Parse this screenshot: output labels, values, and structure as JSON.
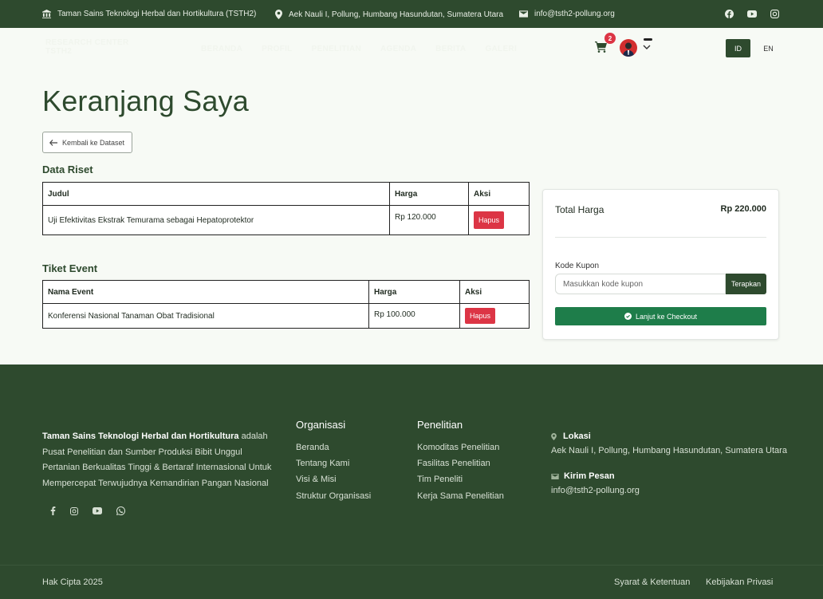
{
  "topbar": {
    "org": "Taman Sains Teknologi Herbal dan Hortikultura (TSTH2)",
    "address": "Aek Nauli I, Pollung, Humbang Hasundutan, Sumatera Utara",
    "email": "info@tsth2-pollung.org",
    "icons": [
      "bank-icon",
      "map-pin-icon",
      "mail-icon",
      "facebook-icon",
      "youtube-icon",
      "instagram-icon"
    ]
  },
  "nav": {
    "logo": "RESEARCH CENTER TSTH2",
    "links": [
      "BERANDA",
      "PROFIL",
      "PENELITIAN",
      "AGENDA",
      "BERITA",
      "GALERI"
    ],
    "cart_count": "2",
    "lang_active": "ID",
    "lang_other": "EN"
  },
  "page": {
    "title": "Keranjang Saya",
    "back_label": "Kembali ke Dataset"
  },
  "riset": {
    "heading": "Data Riset",
    "columns": [
      "Judul",
      "Harga",
      "Aksi"
    ],
    "rows": [
      {
        "title": "Uji Efektivitas Ekstrak Temurama sebagai Hepatoprotektor",
        "price": "Rp 120.000",
        "action": "Hapus"
      }
    ]
  },
  "event": {
    "heading": "Tiket Event",
    "columns": [
      "Nama Event",
      "Harga",
      "Aksi"
    ],
    "rows": [
      {
        "title": "Konferensi Nasional Tanaman Obat Tradisional",
        "price": "Rp 100.000",
        "action": "Hapus"
      }
    ]
  },
  "summary": {
    "total_label": "Total Harga",
    "total_value": "Rp 220.000",
    "coupon_label": "Kode Kupon",
    "coupon_placeholder": "Masukkan kode kupon",
    "apply_label": "Terapkan",
    "checkout_label": "Lanjut ke Checkout"
  },
  "footer": {
    "about_bold": "Taman Sains Teknologi Herbal dan Hortikultura",
    "about_rest": " adalah Pusat Penelitian dan Sumber Produksi Bibit Unggul Pertanian Berkualitas Tinggi & Bertaraf Internasional Untuk Mempercepat Terwujudnya Kemandirian Pangan Nasional",
    "org_heading": "Organisasi",
    "org_links": [
      "Beranda",
      "Tentang Kami",
      "Visi & Misi",
      "Struktur Organisasi"
    ],
    "research_heading": "Penelitian",
    "research_links": [
      "Komoditas Penelitian",
      "Fasilitas Penelitian",
      "Tim Peneliti",
      "Kerja Sama Penelitian"
    ],
    "location_label": "Lokasi",
    "location_value": "Aek Nauli I, Pollung, Humbang Hasundutan, Sumatera Utara",
    "message_label": "Kirim Pesan",
    "message_value": "info@tsth2-pollung.org",
    "copyright": "Hak Cipta 2025",
    "terms": "Syarat & Ketentuan",
    "privacy": "Kebijakan Privasi"
  },
  "colors": {
    "primary": "#2e4a2e",
    "danger": "#dc3545",
    "success": "#1e7d4a",
    "background": "#f7faf5"
  }
}
